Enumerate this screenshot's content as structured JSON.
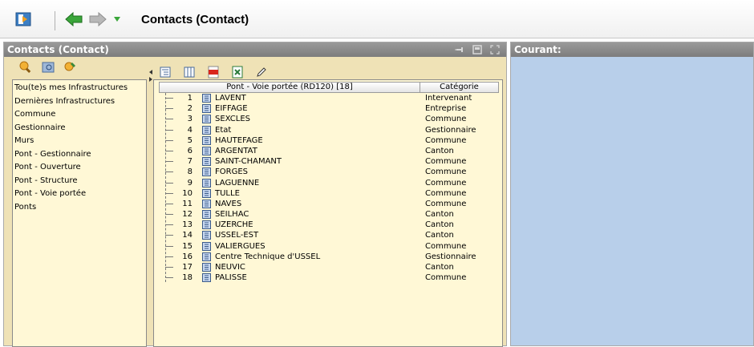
{
  "toolbar": {
    "title": "Contacts (Contact)",
    "icons": [
      "exit-icon",
      "back-arrow-icon",
      "forward-arrow-icon",
      "history-dropdown-icon"
    ]
  },
  "left_panel": {
    "header": "Contacts (Contact)",
    "header_icons": [
      "pin-icon",
      "restore-icon",
      "maximize-icon"
    ],
    "queries": [
      "Tou(te)s mes Infrastructures",
      "Dernières Infrastructures",
      "Commune",
      "Gestionnaire",
      "Murs",
      "Pont - Gestionnaire",
      "Pont - Ouverture",
      "Pont - Structure",
      "Pont - Voie portée",
      "Ponts"
    ]
  },
  "grid": {
    "column_main": "Pont - Voie portée (RD120) [18]",
    "column_category": "Catégorie",
    "rows": [
      {
        "num": "1",
        "name": "LAVENT",
        "category": "Intervenant"
      },
      {
        "num": "2",
        "name": "EIFFAGE",
        "category": "Entreprise"
      },
      {
        "num": "3",
        "name": "SEXCLES",
        "category": "Commune"
      },
      {
        "num": "4",
        "name": "Etat",
        "category": "Gestionnaire"
      },
      {
        "num": "5",
        "name": "HAUTEFAGE",
        "category": "Commune"
      },
      {
        "num": "6",
        "name": "ARGENTAT",
        "category": "Canton"
      },
      {
        "num": "7",
        "name": "SAINT-CHAMANT",
        "category": "Commune"
      },
      {
        "num": "8",
        "name": "FORGES",
        "category": "Commune"
      },
      {
        "num": "9",
        "name": "LAGUENNE",
        "category": "Commune"
      },
      {
        "num": "10",
        "name": "TULLE",
        "category": "Commune"
      },
      {
        "num": "11",
        "name": "NAVES",
        "category": "Commune"
      },
      {
        "num": "12",
        "name": "SEILHAC",
        "category": "Canton"
      },
      {
        "num": "13",
        "name": "UZERCHE",
        "category": "Canton"
      },
      {
        "num": "14",
        "name": "USSEL-EST",
        "category": "Canton"
      },
      {
        "num": "15",
        "name": "VALIERGUES",
        "category": "Commune"
      },
      {
        "num": "16",
        "name": "Centre Technique d'USSEL",
        "category": "Gestionnaire"
      },
      {
        "num": "17",
        "name": "NEUVIC",
        "category": "Canton"
      },
      {
        "num": "18",
        "name": "PALISSE",
        "category": "Commune"
      }
    ]
  },
  "right_panel": {
    "header": "Courant:"
  },
  "colors": {
    "panel_bg": "#efe2b6",
    "list_bg": "#fff8d6",
    "right_bg": "#b8cfea",
    "header_bg": "#8a8a8a",
    "arrow_green": "#3aa63a"
  }
}
